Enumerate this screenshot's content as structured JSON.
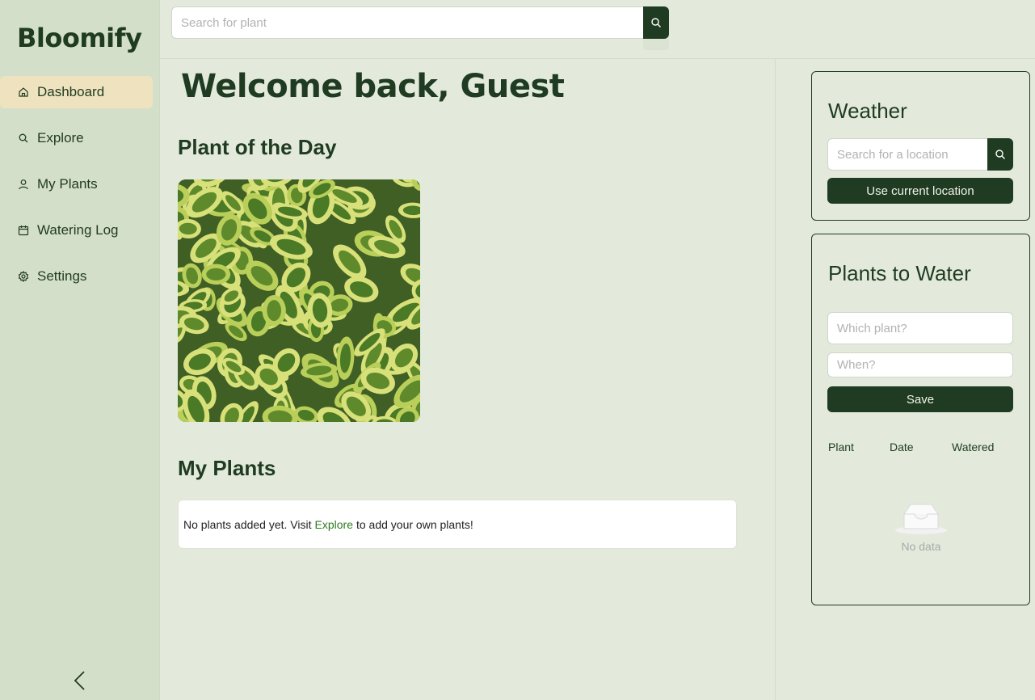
{
  "app": {
    "name": "Bloomify"
  },
  "sidebar": {
    "items": [
      {
        "label": "Dashboard",
        "icon": "home-icon",
        "active": true
      },
      {
        "label": "Explore",
        "icon": "search-icon",
        "active": false
      },
      {
        "label": "My Plants",
        "icon": "user-icon",
        "active": false
      },
      {
        "label": "Watering Log",
        "icon": "calendar-icon",
        "active": false
      },
      {
        "label": "Settings",
        "icon": "gear-icon",
        "active": false
      }
    ],
    "collapse_icon": "chevron-left-icon"
  },
  "topbar": {
    "search_placeholder": "Search for plant"
  },
  "main": {
    "welcome": "Welcome back, Guest",
    "plant_of_day_title": "Plant of the Day",
    "my_plants_title": "My Plants",
    "my_plants_empty_prefix": "No plants added yet. Visit",
    "my_plants_empty_link": "Explore",
    "my_plants_empty_suffix": "to add your own plants!"
  },
  "weather": {
    "title": "Weather",
    "location_placeholder": "Search for a location",
    "use_location_label": "Use current location"
  },
  "plants_to_water": {
    "title": "Plants to Water",
    "plant_placeholder": "Which plant?",
    "when_placeholder": "When?",
    "save_label": "Save",
    "columns": [
      "Plant",
      "Date",
      "Watered"
    ],
    "empty_text": "No data"
  },
  "colors": {
    "primary": "#1f3b21",
    "background": "#e3eadb",
    "sidebar": "#d4dfc9",
    "active": "#efe3bf",
    "link": "#2f7a1e"
  }
}
